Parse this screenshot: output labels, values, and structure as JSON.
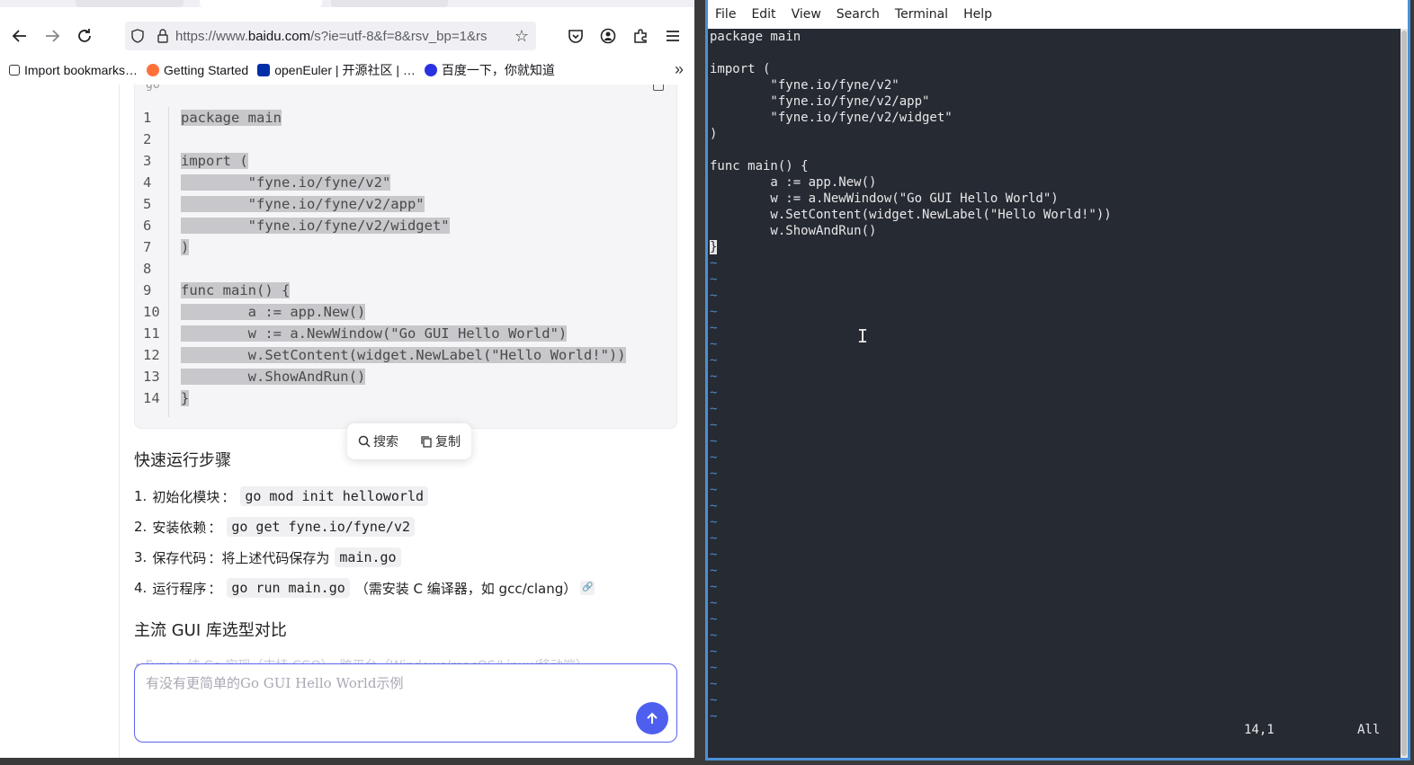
{
  "browser": {
    "url_prefix": "https://www.",
    "url_domain": "baidu.com",
    "url_rest": "/s?ie=utf-8&f=8&rsv_bp=1&rs",
    "bookmarks": [
      {
        "label": "Import bookmarks…",
        "icon": "import-icon",
        "color": "#333333"
      },
      {
        "label": "Getting Started",
        "icon": "firefox-icon",
        "color": "#ff7139"
      },
      {
        "label": "openEuler | 开源社区 | …",
        "icon": "openeuler-icon",
        "color": "#002fa7"
      },
      {
        "label": "百度一下，你就知道",
        "icon": "baidu-paw-icon",
        "color": "#2932e1"
      }
    ],
    "more_label": "»"
  },
  "page": {
    "code_lang": "go",
    "code_lines": [
      {
        "n": "1",
        "text": "package main"
      },
      {
        "n": "2",
        "text": ""
      },
      {
        "n": "3",
        "text": "import ("
      },
      {
        "n": "4",
        "text": "        \"fyne.io/fyne/v2\""
      },
      {
        "n": "5",
        "text": "        \"fyne.io/fyne/v2/app\""
      },
      {
        "n": "6",
        "text": "        \"fyne.io/fyne/v2/widget\""
      },
      {
        "n": "7",
        "text": ")"
      },
      {
        "n": "8",
        "text": ""
      },
      {
        "n": "9",
        "text": "func main() {"
      },
      {
        "n": "10",
        "text": "        a := app.New()"
      },
      {
        "n": "11",
        "text": "        w := a.NewWindow(\"Go GUI Hello World\")"
      },
      {
        "n": "12",
        "text": "        w.SetContent(widget.NewLabel(\"Hello World!\"))"
      },
      {
        "n": "13",
        "text": "        w.ShowAndRun()"
      },
      {
        "n": "14",
        "text": "}"
      }
    ],
    "popover": {
      "search": "搜索",
      "copy": "复制"
    },
    "steps_title": "快速运行步骤",
    "steps": [
      {
        "num": "1.",
        "key": "初始化模块",
        "colon": "：",
        "pre": "",
        "code": "go mod init helloworld",
        "post": ""
      },
      {
        "num": "2.",
        "key": "安装依赖",
        "colon": "：",
        "pre": "",
        "code": "go get fyne.io/fyne/v2",
        "post": ""
      },
      {
        "num": "3.",
        "key": "保存代码",
        "colon": "：",
        "pre": "将上述代码保存为",
        "code": "main.go",
        "post": ""
      },
      {
        "num": "4.",
        "key": "运行程序",
        "colon": "：",
        "pre": "",
        "code": "go run main.go",
        "post": "（需安装 C 编译器，如 gcc/clang）"
      }
    ],
    "gui_title": "主流 GUI 库选型对比",
    "faded_line": "• Fyne：纯 Go 实现（支持 CGO），跨平台（Windows/macOS/Linux/移动端）",
    "chat_placeholder": "有没有更简单的Go GUI Hello World示例"
  },
  "terminal": {
    "menu": [
      "File",
      "Edit",
      "View",
      "Search",
      "Terminal",
      "Help"
    ],
    "lines": [
      "package main",
      "",
      "import (",
      "        \"fyne.io/fyne/v2\"",
      "        \"fyne.io/fyne/v2/app\"",
      "        \"fyne.io/fyne/v2/widget\"",
      ")",
      "",
      "func main() {",
      "        a := app.New()",
      "        w := a.NewWindow(\"Go GUI Hello World\")",
      "        w.SetContent(widget.NewLabel(\"Hello World!\"))",
      "        w.ShowAndRun()"
    ],
    "cursor_line": "}",
    "tilde": "~",
    "tilde_count": 29,
    "status_pos": "14,1",
    "status_all": "All"
  }
}
